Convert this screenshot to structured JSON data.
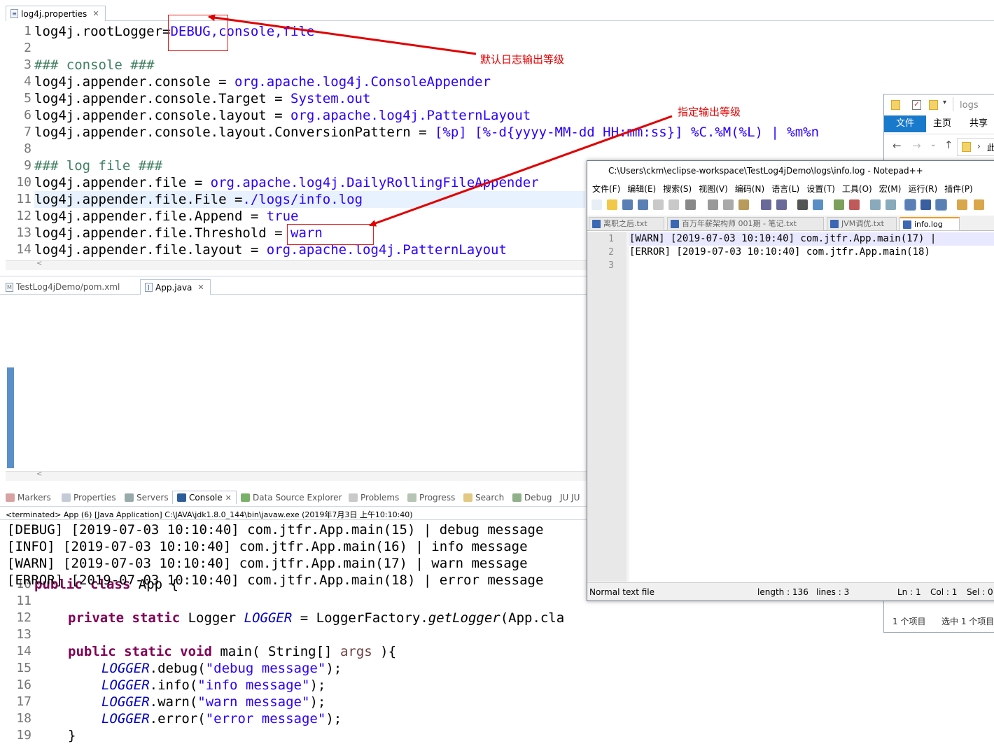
{
  "top_editor": {
    "tab_label": "log4j.properties",
    "lines": [
      {
        "n": "1",
        "t": "log4j.rootLogger=",
        "v": "DEBUG,console,file"
      },
      {
        "n": "2",
        "t": "",
        "v": ""
      },
      {
        "n": "3",
        "c": "### console ###"
      },
      {
        "n": "4",
        "t": "log4j.appender.console = ",
        "v": "org.apache.log4j.ConsoleAppender"
      },
      {
        "n": "5",
        "t": "log4j.appender.console.Target = ",
        "v": "System.out"
      },
      {
        "n": "6",
        "t": "log4j.appender.console.layout = ",
        "v": "org.apache.log4j.PatternLayout"
      },
      {
        "n": "7",
        "t": "log4j.appender.console.layout.ConversionPattern = ",
        "v": "[%p] [%-d{yyyy-MM-dd HH:mm:ss}] %C.%M(%L) | %m%n"
      },
      {
        "n": "8",
        "t": "",
        "v": ""
      },
      {
        "n": "9",
        "c": "### log file ###"
      },
      {
        "n": "10",
        "t": "log4j.appender.file = ",
        "v": "org.apache.log4j.DailyRollingFileAppender"
      },
      {
        "n": "11",
        "t": "log4j.appender.file.File =",
        "v": "./logs/info.log"
      },
      {
        "n": "12",
        "t": "log4j.appender.file.Append = ",
        "v": "true"
      },
      {
        "n": "13",
        "t": "log4j.appender.file.Threshold = ",
        "v": "warn"
      },
      {
        "n": "14",
        "t": "log4j.appender.file.layout = ",
        "v": "org.apache.log4j.PatternLayout"
      }
    ]
  },
  "java_editor": {
    "tab_pom": "TestLog4jDemo/pom.xml",
    "tab_app": "App.java",
    "line_numbers": [
      "10",
      "11",
      "12",
      "13",
      "14",
      "15",
      "16",
      "17",
      "18",
      "19"
    ],
    "l10_kw": "public class",
    "l10_rest": " App {",
    "l12_kw": "private static",
    "l12_type": " Logger ",
    "l12_field": "LOGGER",
    "l12_eq": " = LoggerFactory.",
    "l12_meth": "getLogger",
    "l12_tail": "(App.cla",
    "l14_kw": "public static void",
    "l14_mid": " main( String[] ",
    "l14_param": "args",
    "l14_end": " ){",
    "calls": [
      {
        "f": "LOGGER",
        "m": ".debug(",
        "s": "\"debug message\"",
        "e": ");"
      },
      {
        "f": "LOGGER",
        "m": ".info(",
        "s": "\"info message\"",
        "e": ");"
      },
      {
        "f": "LOGGER",
        "m": ".warn(",
        "s": "\"warn message\"",
        "e": ");"
      },
      {
        "f": "LOGGER",
        "m": ".error(",
        "s": "\"error message\"",
        "e": ");"
      }
    ],
    "l19": "}"
  },
  "console": {
    "tabs": [
      "Markers",
      "Properties",
      "Servers",
      "Console",
      "Data Source Explorer",
      "Problems",
      "Progress",
      "Search",
      "Debug",
      "JU JU"
    ],
    "terminated": "<terminated> App (6) [Java Application] C:\\JAVA\\jdk1.8.0_144\\bin\\javaw.exe (2019年7月3日 上午10:10:40)",
    "output": [
      "[DEBUG] [2019-07-03 10:10:40] com.jtfr.App.main(15) | debug message",
      "[INFO] [2019-07-03 10:10:40] com.jtfr.App.main(16) | info message",
      "[WARN] [2019-07-03 10:10:40] com.jtfr.App.main(17) | warn message",
      "[ERROR] [2019-07-03 10:10:40] com.jtfr.App.main(18) | error message"
    ]
  },
  "notepad": {
    "title": "C:\\Users\\ckm\\eclipse-workspace\\TestLog4jDemo\\logs\\info.log - Notepad++",
    "menu": [
      "文件(F)",
      "编辑(E)",
      "搜索(S)",
      "视图(V)",
      "编码(N)",
      "语言(L)",
      "设置(T)",
      "工具(O)",
      "宏(M)",
      "运行(R)",
      "插件(P)"
    ],
    "tabs": [
      "离职之后.txt",
      "百万年薪架构师 001期 - 笔记.txt",
      "JVM调优.txt",
      "info.log"
    ],
    "line_numbers": [
      "1",
      "2",
      "3"
    ],
    "lines": [
      "[WARN] [2019-07-03 10:10:40] com.jtfr.App.main(17) |",
      "[ERROR] [2019-07-03 10:10:40] com.jtfr.App.main(18)",
      ""
    ],
    "status_type": "Normal text file",
    "status_length": "length : 136",
    "status_lines": "lines : 3",
    "status_ln": "Ln : 1",
    "status_col": "Col : 1",
    "status_sel": "Sel : 0"
  },
  "explorer": {
    "path": "logs",
    "ribbon": [
      "文件",
      "主页",
      "共享"
    ],
    "footer_count": "1 个项目",
    "footer_sel": "选中 1 个项目",
    "nav_cut": "此"
  },
  "annotations": {
    "default_level": "默认日志输出等级",
    "specified_level": "指定输出等级"
  },
  "colors": {
    "annotation": "#e00000",
    "eclipse_keyword": "#7f0055",
    "eclipse_string": "#2a00ff",
    "ribbon_active": "#1979ca"
  }
}
